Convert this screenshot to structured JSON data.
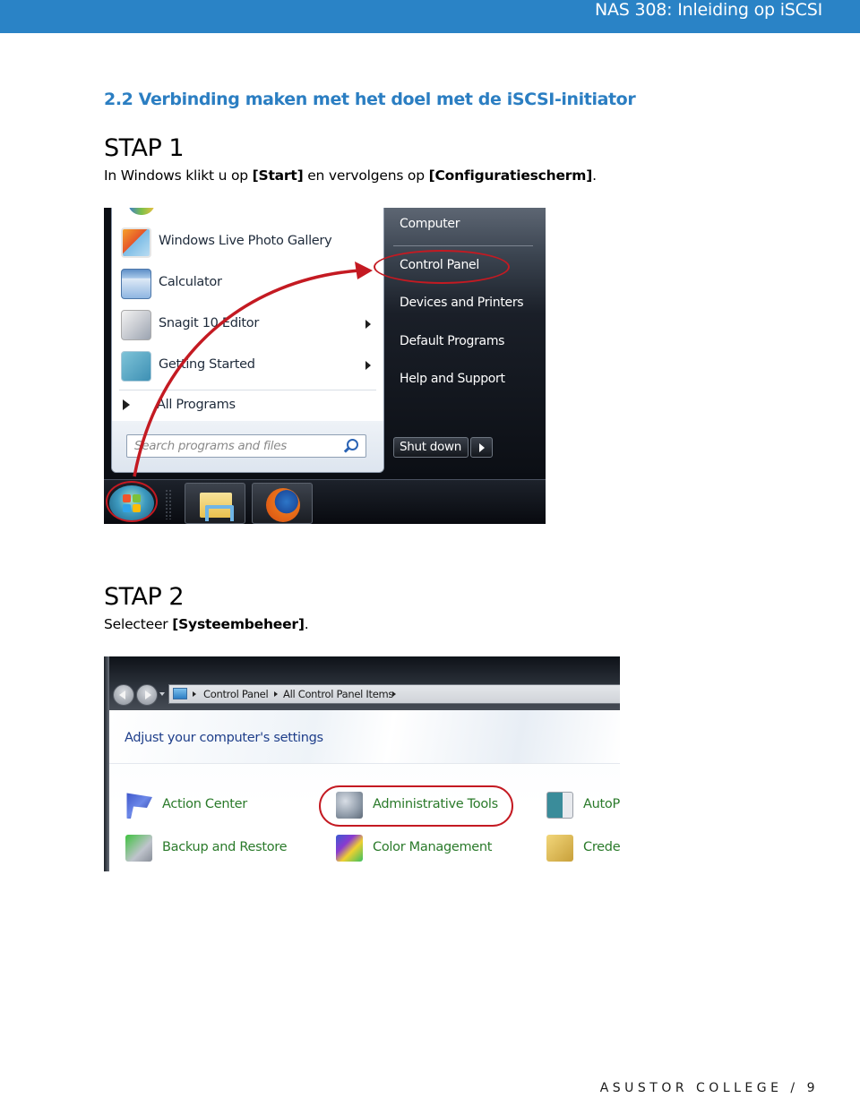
{
  "header": {
    "title": "NAS 308: Inleiding op iSCSI",
    "color": "#2a83c6"
  },
  "section": {
    "heading": "2.2 Verbinding maken met het doel met de iSCSI-initiator",
    "color": "#2b7ec2"
  },
  "steps": [
    {
      "title": "STAP 1",
      "text_parts": [
        "In Windows klikt u op ",
        "[Start]",
        " en vervolgens op ",
        "[Configuratiescherm]",
        "."
      ]
    },
    {
      "title": "STAP 2",
      "text_parts": [
        "Selecteer ",
        "[Systeembeheer]",
        "."
      ]
    }
  ],
  "start_menu": {
    "programs": [
      {
        "label": "Windows Live Photo Gallery",
        "icon": "photo-gallery-icon",
        "has_submenu": false
      },
      {
        "label": "Calculator",
        "icon": "calculator-icon",
        "has_submenu": false
      },
      {
        "label": "Snagit 10 Editor",
        "icon": "snagit-icon",
        "has_submenu": true
      },
      {
        "label": "Getting Started",
        "icon": "getting-started-icon",
        "has_submenu": true
      }
    ],
    "all_programs_label": "All Programs",
    "search_placeholder": "Search programs and files",
    "right_links": [
      "Computer",
      "Control Panel",
      "Devices and Printers",
      "Default Programs",
      "Help and Support"
    ],
    "highlighted_link": "Control Panel",
    "shutdown_label": "Shut down",
    "taskbar_items": [
      "start-orb-icon",
      "windows-explorer-icon",
      "firefox-icon"
    ],
    "annotation_color": "#c41a22"
  },
  "control_panel": {
    "breadcrumb": [
      "Control Panel",
      "All Control Panel Items"
    ],
    "heading": "Adjust your computer's settings",
    "items": [
      {
        "label": "Action Center",
        "icon": "action-center-flag-icon"
      },
      {
        "label": "Administrative Tools",
        "icon": "administrative-tools-icon",
        "highlighted": true
      },
      {
        "label": "AutoPl",
        "icon": "autoplay-icon"
      },
      {
        "label": "Backup and Restore",
        "icon": "backup-restore-icon"
      },
      {
        "label": "Color Management",
        "icon": "color-management-icon"
      },
      {
        "label": "Creder",
        "icon": "credential-manager-icon"
      }
    ],
    "link_color": "#2a7a2a"
  },
  "footer": {
    "text": "ASUSTOR COLLEGE / 9"
  }
}
